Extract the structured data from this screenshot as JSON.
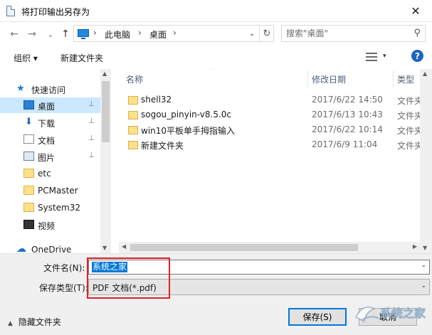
{
  "window": {
    "title": "将打印输出另存为",
    "close_glyph": "✕"
  },
  "nav": {
    "back_glyph": "←",
    "forward_glyph": "→",
    "recent_glyph": "⌄",
    "up_glyph": "↑",
    "breadcrumbs": [
      "此电脑",
      "桌面"
    ],
    "crumb_sep": "›",
    "address_dd_glyph": "⌄",
    "refresh_glyph": "↻",
    "search_placeholder": "搜索\"桌面\"",
    "search_glyph": "⚲"
  },
  "toolbar": {
    "organize": "组织 ▾",
    "new_folder": "新建文件夹",
    "view_dd": "▾",
    "help": "?"
  },
  "sidebar": {
    "items": [
      {
        "label": "快速访问",
        "icon": "star-icon",
        "pinned": false
      },
      {
        "label": "桌面",
        "icon": "desktop-icon",
        "pinned": true,
        "selected": true
      },
      {
        "label": "下载",
        "icon": "download-icon",
        "pinned": true
      },
      {
        "label": "文档",
        "icon": "document-icon",
        "pinned": true
      },
      {
        "label": "图片",
        "icon": "picture-icon",
        "pinned": true
      },
      {
        "label": "etc",
        "icon": "folder-icon",
        "pinned": false
      },
      {
        "label": "PCMaster",
        "icon": "folder-icon",
        "pinned": false
      },
      {
        "label": "System32",
        "icon": "folder-icon",
        "pinned": false
      },
      {
        "label": "视频",
        "icon": "video-icon",
        "pinned": false
      },
      {
        "label": "OneDrive",
        "icon": "cloud-icon",
        "pinned": false
      }
    ],
    "pin_glyph": "📌"
  },
  "files": {
    "columns": [
      "名称",
      "修改日期",
      "类型"
    ],
    "sort_glyph": "^",
    "rows": [
      {
        "name": "shell32",
        "date": "2017/6/22 14:50",
        "type": "文件夹"
      },
      {
        "name": "sogou_pinyin-v8.5.0c",
        "date": "2017/6/13 10:43",
        "type": "文件夹"
      },
      {
        "name": "win10平板单手拇指输入",
        "date": "2017/6/22 10:14",
        "type": "文件夹"
      },
      {
        "name": "新建文件夹",
        "date": "2017/6/9 11:04",
        "type": "文件夹"
      }
    ]
  },
  "scroll": {
    "up": "▲",
    "down": "▼",
    "left": "◀",
    "right": "▶"
  },
  "form": {
    "filename_label": "文件名(N):",
    "filename_value": "系统之家",
    "filetype_label": "保存类型(T):",
    "filetype_value": "PDF 文档(*.pdf)",
    "dd_glyph": "⌄"
  },
  "footer": {
    "hide_folders": "隐藏文件夹",
    "hide_caret": "▲",
    "save": "保存(S)",
    "cancel": "取消"
  },
  "watermark_text": "系统之家",
  "colors": {
    "accent": "#0078d7",
    "selection": "#cce8ff",
    "highlight_box": "#e0202a"
  }
}
